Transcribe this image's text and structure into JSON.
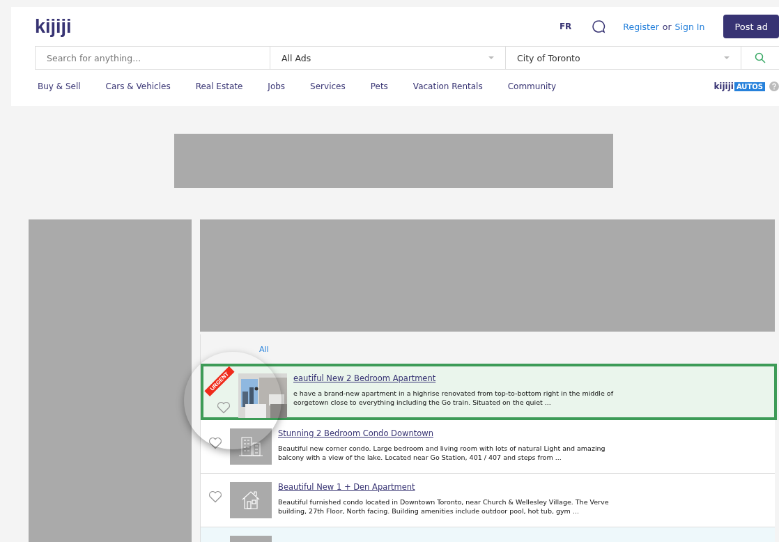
{
  "header": {
    "logo": "kijiji",
    "language": "FR",
    "register": "Register",
    "or": "or",
    "sign_in": "Sign In",
    "post_ad": "Post ad"
  },
  "search": {
    "placeholder": "Search for anything...",
    "category": "All Ads",
    "location": "City of Toronto"
  },
  "nav": [
    "Buy & Sell",
    "Cars & Vehicles",
    "Real Estate",
    "Jobs",
    "Services",
    "Pets",
    "Vacation Rentals",
    "Community"
  ],
  "autos": {
    "brand": "kijiji",
    "badge": "AUTOS"
  },
  "listings_header": {
    "link": "All"
  },
  "listings": [
    {
      "kind": "urgent",
      "highlighted": true,
      "badge": "URGENT",
      "title": "eautiful New 2 Bedroom Apartment",
      "description": "e have a brand-new apartment in a highrise renovated from top-to-bottom right in the middle of eorgetown close to everything including the Go train. Situated on the quiet ..."
    },
    {
      "kind": "regular",
      "highlighted": false,
      "thumbnail": {
        "kind": "building"
      },
      "title": "Stunning 2 Bedroom Condo Downtown",
      "description": "Beautiful new corner condo. Large bedroom and living room with lots of natural Light and amazing balcony with a view of the lake. Located near Go Station, 401 / 407 and steps from ..."
    },
    {
      "kind": "regular",
      "highlighted": false,
      "thumbnail": {
        "kind": "house"
      },
      "title": "Beautiful New 1 + Den Apartment",
      "description": "Beautiful furnished condo located in Downtown Toronto, near Church & Wellesley Village. The Verve building, 27th Floor, North facing. Building amenities include outdoor pool, hot tub, gym ..."
    },
    {
      "kind": "featured",
      "highlighted": false,
      "thumbnail": {
        "kind": "blank"
      }
    }
  ]
}
